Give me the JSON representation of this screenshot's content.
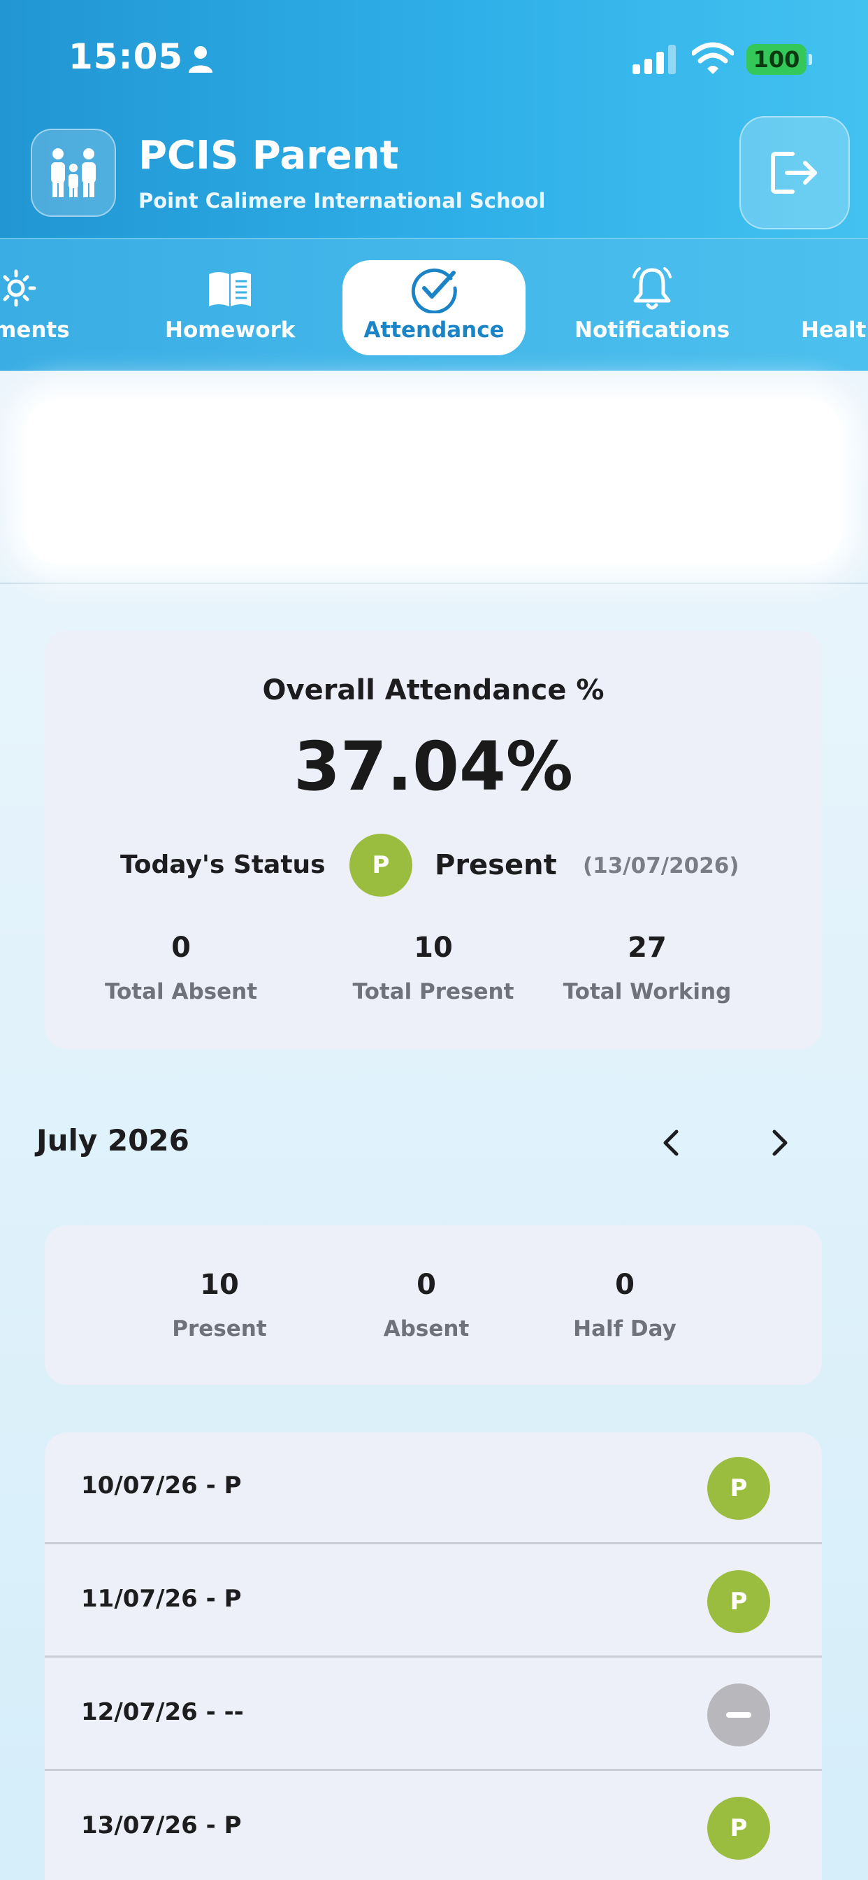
{
  "status_bar": {
    "time": "15:05",
    "battery": "100"
  },
  "app": {
    "title": "PCIS Parent",
    "subtitle": "Point Calimere International School"
  },
  "tabs": [
    {
      "label": "ements",
      "icon": "sun-icon"
    },
    {
      "label": "Homework",
      "icon": "book-icon"
    },
    {
      "label": "Attendance",
      "icon": "check-circle-icon",
      "active": true
    },
    {
      "label": "Notifications",
      "icon": "bell-icon"
    },
    {
      "label": "Healt",
      "icon": "health-icon"
    }
  ],
  "summary": {
    "title": "Overall Attendance %",
    "percent": "37.04%",
    "today_label": "Today's Status",
    "today_code": "P",
    "today_status": "Present",
    "today_date": "(13/07/2026)",
    "stats": [
      {
        "value": "0",
        "label": "Total Absent"
      },
      {
        "value": "10",
        "label": "Total Present"
      },
      {
        "value": "27",
        "label": "Total Working"
      }
    ]
  },
  "month": {
    "label": "July 2026",
    "counts": [
      {
        "value": "10",
        "label": "Present"
      },
      {
        "value": "0",
        "label": "Absent"
      },
      {
        "value": "0",
        "label": "Half Day"
      }
    ]
  },
  "days": [
    {
      "label": "10/07/26 - P",
      "code": "P",
      "status": "present"
    },
    {
      "label": "11/07/26 - P",
      "code": "P",
      "status": "present"
    },
    {
      "label": "12/07/26 - --",
      "code": "",
      "status": "none"
    },
    {
      "label": "13/07/26 - P",
      "code": "P",
      "status": "present"
    }
  ],
  "colors": {
    "present": "#9bbd3f",
    "none": "#b8b8bc",
    "accent": "#1a84c6"
  }
}
